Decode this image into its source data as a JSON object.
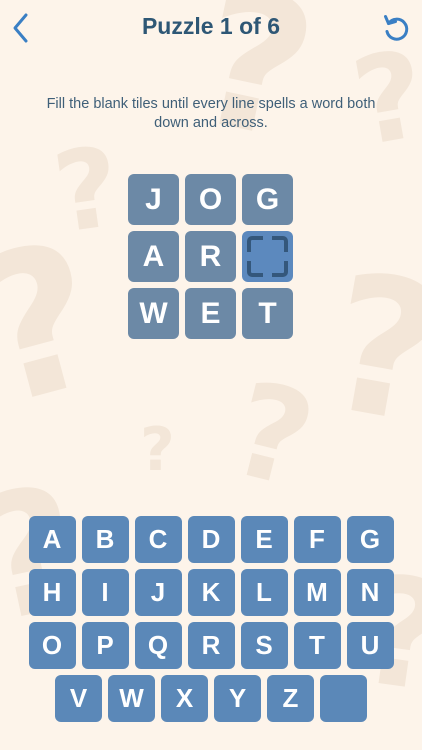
{
  "header": {
    "title": "Puzzle 1 of 6",
    "back_icon": "chevron-left-icon",
    "reset_icon": "undo-icon"
  },
  "instructions": "Fill the blank tiles until every line spells a word both down and across.",
  "colors": {
    "background": "#fdf4ea",
    "title": "#2e5775",
    "tile": "#6c89a6",
    "tile_empty": "#5c89be",
    "key": "#5b88b8"
  },
  "grid": [
    [
      "J",
      "O",
      "G"
    ],
    [
      "A",
      "R",
      ""
    ],
    [
      "W",
      "E",
      "T"
    ]
  ],
  "keyboard": [
    [
      "A",
      "B",
      "C",
      "D",
      "E",
      "F",
      "G"
    ],
    [
      "H",
      "I",
      "J",
      "K",
      "L",
      "M",
      "N"
    ],
    [
      "O",
      "P",
      "Q",
      "R",
      "S",
      "T",
      "U"
    ],
    [
      "V",
      "W",
      "X",
      "Y",
      "Z",
      ""
    ]
  ]
}
